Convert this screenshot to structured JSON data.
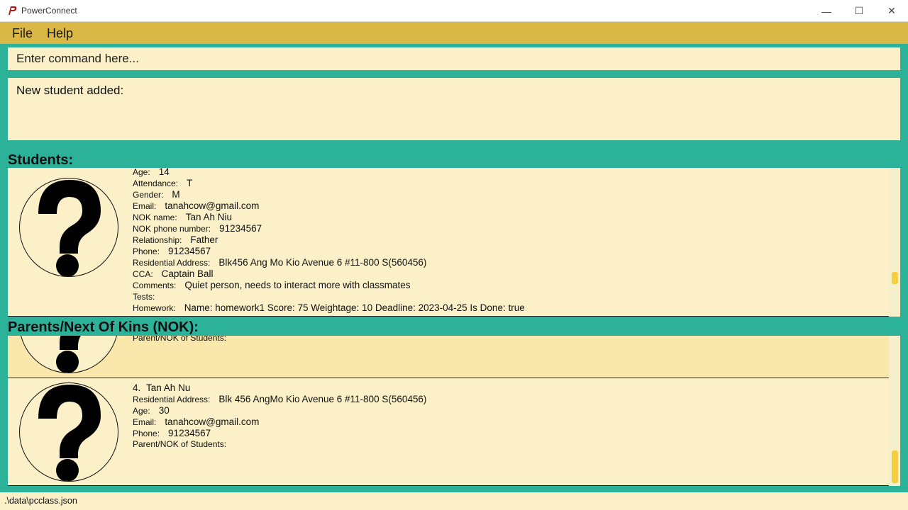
{
  "window": {
    "title": "PowerConnect",
    "minimize_glyph": "—",
    "maximize_glyph": "☐",
    "close_glyph": "✕",
    "icon": "powerconnect-logo-icon"
  },
  "menu": {
    "file": "File",
    "help": "Help"
  },
  "command": {
    "placeholder": "Enter command here..."
  },
  "result": {
    "text": "New student added:"
  },
  "students": {
    "heading": "Students:",
    "card": {
      "age_label": "Age:",
      "age": "14",
      "attendance_label": "Attendance:",
      "attendance": "T",
      "gender_label": "Gender:",
      "gender": "M",
      "email_label": "Email:",
      "email": "tanahcow@gmail.com",
      "nok_name_label": "NOK name:",
      "nok_name": "Tan Ah Niu",
      "nok_phone_label": "NOK phone number:",
      "nok_phone": "91234567",
      "relationship_label": "Relationship:",
      "relationship": "Father",
      "phone_label": "Phone:",
      "phone": "91234567",
      "address_label": "Residential Address:",
      "address": "Blk456 Ang Mo Kio Avenue 6 #11-800 S(560456)",
      "cca_label": "CCA:",
      "cca": "Captain Ball",
      "comments_label": "Comments:",
      "comments": "Quiet person, needs to interact more with classmates",
      "tests_label": "Tests:",
      "tests": "",
      "homework_label": "Homework:",
      "homework": "Name: homework1 Score: 75 Weightage: 10 Deadline: 2023-04-25 Is Done: true"
    }
  },
  "parents": {
    "heading": "Parents/Next Of Kins (NOK):",
    "prev_card": {
      "students_label": "Parent/NOK of Students:"
    },
    "card": {
      "index": "4.",
      "name": "Tan Ah Nu",
      "address_label": "Residential Address:",
      "address": "Blk 456 AngMo Kio Avenue 6 #11-800 S(560456)",
      "age_label": "Age:",
      "age": "30",
      "email_label": "Email:",
      "email": "tanahcow@gmail.com",
      "phone_label": "Phone:",
      "phone": "91234567",
      "students_label": "Parent/NOK of Students:"
    }
  },
  "status": {
    "file_path": ".\\data\\pcclass.json"
  },
  "colors": {
    "background": "#2db29a",
    "menu": "#dbb845",
    "panel": "#fbf0c8",
    "scroll_thumb": "#f3cf3c"
  }
}
